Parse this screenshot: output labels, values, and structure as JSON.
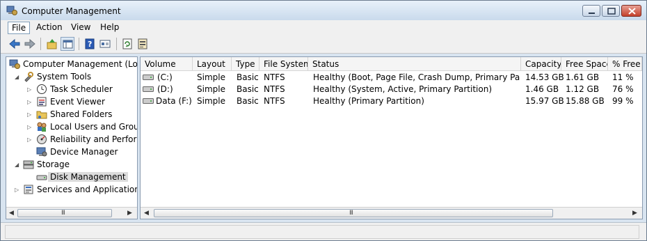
{
  "window": {
    "title": "Computer Management"
  },
  "menubar": {
    "items": [
      "File",
      "Action",
      "View",
      "Help"
    ]
  },
  "toolbar": {
    "buttons": [
      "back-icon",
      "forward-icon",
      "up-folder-icon",
      "show-tree-icon",
      "help-icon",
      "properties-icon",
      "refresh-icon",
      "export-icon"
    ]
  },
  "tree": {
    "items": [
      {
        "label": "Computer Management (Local",
        "icon": "computer-management-icon"
      },
      {
        "label": "System Tools",
        "icon": "tools-icon"
      },
      {
        "label": "Task Scheduler",
        "icon": "clock-icon"
      },
      {
        "label": "Event Viewer",
        "icon": "event-viewer-icon"
      },
      {
        "label": "Shared Folders",
        "icon": "shared-folder-icon"
      },
      {
        "label": "Local Users and Groups",
        "icon": "users-icon"
      },
      {
        "label": "Reliability and Performa",
        "icon": "performance-icon"
      },
      {
        "label": "Device Manager",
        "icon": "device-manager-icon"
      },
      {
        "label": "Storage",
        "icon": "storage-icon"
      },
      {
        "label": "Disk Management",
        "icon": "disk-icon"
      },
      {
        "label": "Services and Applications",
        "icon": "services-icon"
      }
    ]
  },
  "volumes": {
    "headers": [
      "Volume",
      "Layout",
      "Type",
      "File System",
      "Status",
      "Capacity",
      "Free Space",
      "% Free"
    ],
    "rows": [
      [
        "(C:)",
        "Simple",
        "Basic",
        "NTFS",
        "Healthy (Boot, Page File, Crash Dump, Primary Partiti...",
        "14.53 GB",
        "1.61 GB",
        "11 %"
      ],
      [
        "(D:)",
        "Simple",
        "Basic",
        "NTFS",
        "Healthy (System, Active, Primary Partition)",
        "1.46 GB",
        "1.12 GB",
        "76 %"
      ],
      [
        "Data (F:)",
        "Simple",
        "Basic",
        "NTFS",
        "Healthy (Primary Partition)",
        "15.97 GB",
        "15.88 GB",
        "99 %"
      ]
    ]
  },
  "scroll": {
    "grip": "III"
  }
}
